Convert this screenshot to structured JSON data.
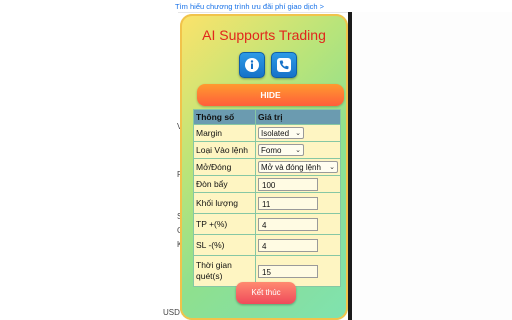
{
  "background": {
    "promo_link": "Tìm hiểu chương trình ưu đãi phí giao dịch >",
    "fragments": [
      "V",
      "P",
      "S",
      "G",
      "K",
      "USDT"
    ]
  },
  "panel": {
    "title": "AI Supports Trading",
    "info_icon": "info-icon",
    "phone_icon": "phone-icon",
    "hide_label": "HIDE",
    "submit_label": "Kết thúc"
  },
  "table": {
    "headers": [
      "Thông số",
      "Giá trị"
    ],
    "rows": [
      {
        "label": "Margin",
        "value": "Isolated"
      },
      {
        "label": "Loại Vào lệnh",
        "value": "Fomo"
      },
      {
        "label": "Mở/Đóng",
        "value": "Mở và đóng lệnh"
      },
      {
        "label": "Đòn bẩy",
        "value": "100"
      },
      {
        "label": "Khối lượng",
        "value": "11"
      },
      {
        "label": "TP +(%)",
        "value": "4"
      },
      {
        "label": "SL -(%)",
        "value": "4"
      },
      {
        "label": "Thời gian quét(s)",
        "value": "15"
      }
    ]
  },
  "colors": {
    "title": "#e1261c",
    "hide_button": "#ff6f34",
    "header_row": "#6b9bb0",
    "cell_bg": "#fef5c2",
    "submit_button": "#ef4a5b"
  }
}
